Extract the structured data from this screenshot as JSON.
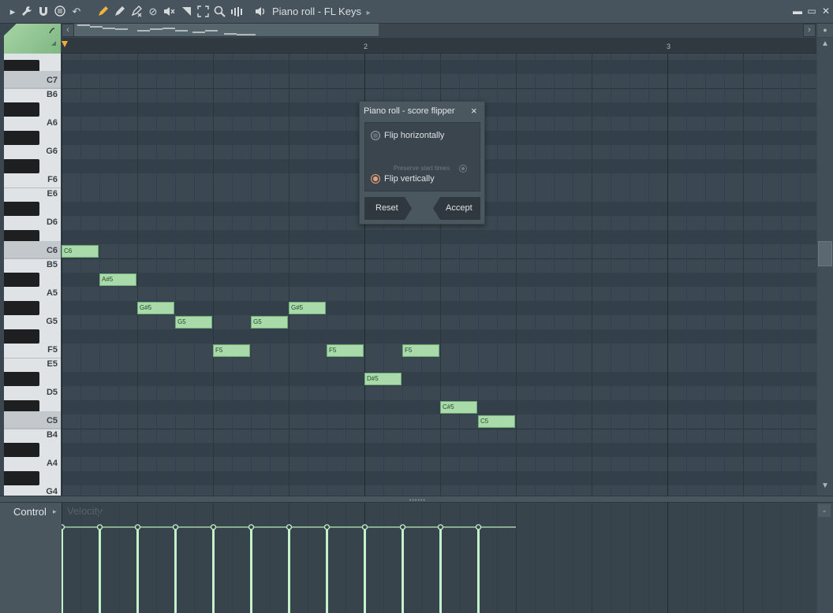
{
  "window": {
    "title": "Piano roll - FL Keys",
    "minimize_icon": "minimize-icon",
    "maximize_icon": "maximize-icon",
    "close_icon": "close-icon"
  },
  "toolbar": {
    "icons": [
      "play-arrow-icon",
      "wrench-icon",
      "magnet-icon",
      "menu-circle-icon",
      "undo-icon",
      "pencil-icon",
      "brush-icon",
      "delete-icon",
      "mute-icon",
      "speaker-mute-icon",
      "slice-icon",
      "select-icon",
      "zoom-icon",
      "playback-icon",
      "speaker-icon"
    ],
    "title_arrow": "▸"
  },
  "ruler": {
    "bars": [
      "2",
      "3"
    ]
  },
  "piano_keys": {
    "labels": [
      "C7",
      "B6",
      "A6",
      "G6",
      "F6",
      "E6",
      "D6",
      "C6",
      "B5",
      "A5",
      "G5",
      "F5",
      "E5",
      "D5",
      "C5",
      "B4",
      "A4",
      "G4"
    ]
  },
  "notes": [
    {
      "label": "C6",
      "pitch": "C6",
      "step": 0
    },
    {
      "label": "A#5",
      "pitch": "A#5",
      "step": 1
    },
    {
      "label": "G#5",
      "pitch": "G#5",
      "step": 2
    },
    {
      "label": "G5",
      "pitch": "G5",
      "step": 3
    },
    {
      "label": "F5",
      "pitch": "F5",
      "step": 4
    },
    {
      "label": "G5",
      "pitch": "G5",
      "step": 5
    },
    {
      "label": "G#5",
      "pitch": "G#5",
      "step": 6
    },
    {
      "label": "F5",
      "pitch": "F5",
      "step": 7
    },
    {
      "label": "D#5",
      "pitch": "D#5",
      "step": 8
    },
    {
      "label": "F5",
      "pitch": "F5",
      "step": 9
    },
    {
      "label": "C#5",
      "pitch": "C#5",
      "step": 10
    },
    {
      "label": "C5",
      "pitch": "C5",
      "step": 11
    }
  ],
  "dialog": {
    "title": "Piano roll - score flipper",
    "close_icon": "×",
    "option_horizontal": "Flip horizontally",
    "preserve_label": "Preserve start times",
    "option_vertical": "Flip vertically",
    "selected": "Flip vertically",
    "reset_label": "Reset",
    "accept_label": "Accept"
  },
  "control": {
    "label": "Control",
    "arrow": "▸",
    "placeholder": "Velocity",
    "minus": "-"
  },
  "colors": {
    "note_fill": "#a8dba9",
    "radio_on": "#f39b73",
    "playhead": "#f6a93b"
  }
}
